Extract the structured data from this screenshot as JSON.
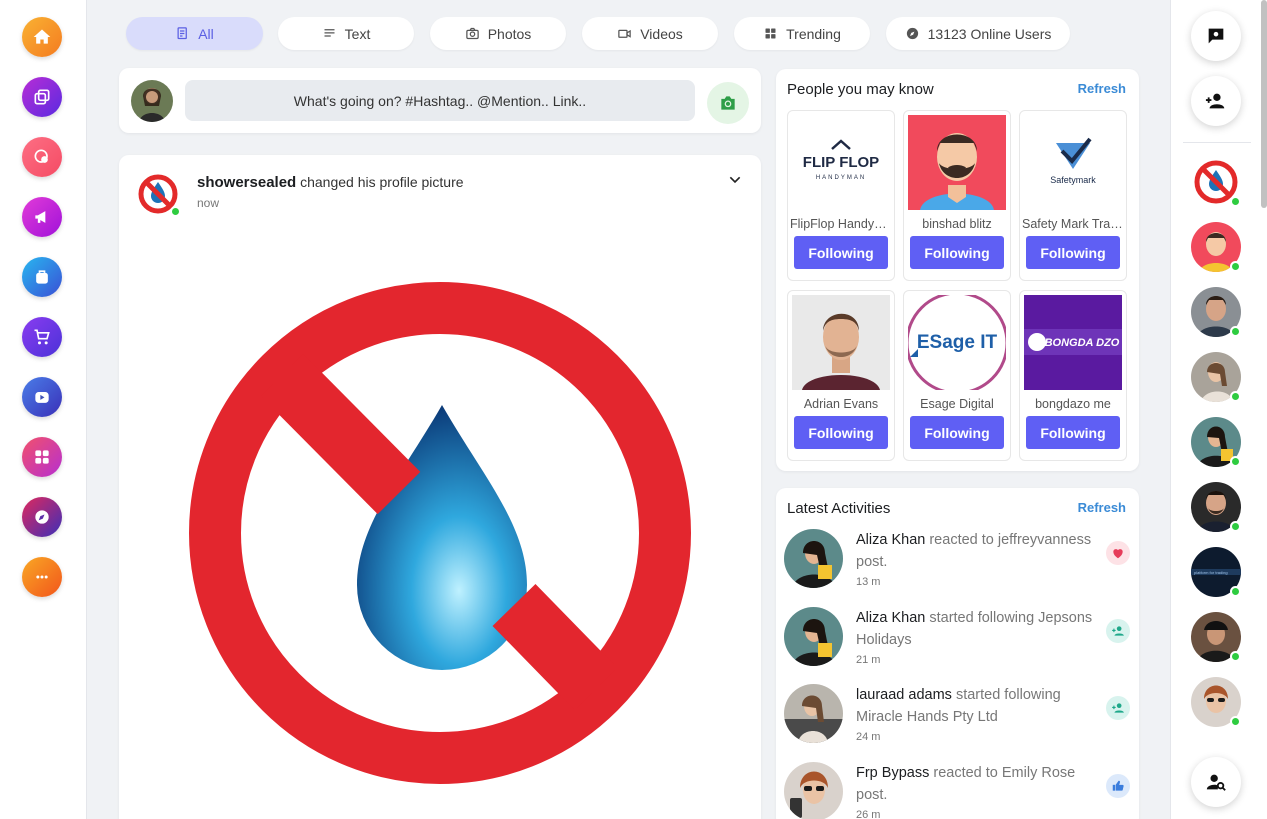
{
  "colors": {
    "accent": "#5f5ff4",
    "link": "#3b8bd6",
    "online": "#2ecc40"
  },
  "left_nav": [
    {
      "name": "home",
      "icon": "home-icon",
      "color": "#f7a21b"
    },
    {
      "name": "pages",
      "icon": "pages-icon",
      "color": "#8e2de2"
    },
    {
      "name": "groups",
      "icon": "groups-icon",
      "color": "#f64f59"
    },
    {
      "name": "ads",
      "icon": "megaphone-icon",
      "color": "#c622d6"
    },
    {
      "name": "market",
      "icon": "bag-icon",
      "color": "#3a7bd5"
    },
    {
      "name": "shop",
      "icon": "cart-icon",
      "color": "#6a3de8"
    },
    {
      "name": "watch",
      "icon": "video-icon",
      "color": "#3f51b5"
    },
    {
      "name": "apps",
      "icon": "apps-icon",
      "color": "#e94057"
    },
    {
      "name": "explore",
      "icon": "compass-icon",
      "color": "#5b2fa8"
    },
    {
      "name": "more",
      "icon": "more-icon",
      "color": "#f5a623"
    }
  ],
  "filters": {
    "all": "All",
    "text": "Text",
    "photos": "Photos",
    "videos": "Videos",
    "trending": "Trending",
    "online": "13123 Online Users"
  },
  "composer": {
    "placeholder": "What's going on? #Hashtag.. @Mention.. Link.."
  },
  "post": {
    "author": "showersealed",
    "action": " changed his profile picture",
    "time": "now"
  },
  "people": {
    "title": "People you may know",
    "refresh": "Refresh",
    "items": [
      {
        "name": "FlipFlop Handyman",
        "button": "Following"
      },
      {
        "name": "binshad blitz",
        "button": "Following"
      },
      {
        "name": "Safety Mark Training",
        "button": "Following"
      },
      {
        "name": "Adrian Evans",
        "button": "Following"
      },
      {
        "name": "Esage Digital",
        "button": "Following"
      },
      {
        "name": "bongdazo me",
        "button": "Following"
      }
    ],
    "logos": {
      "flipflop_top": "FLIP FLOP",
      "flipflop_sub": "HANDYMAN",
      "safety": "Safetymark",
      "esage": "ESage IT",
      "bongda": "BONGDA DZO"
    }
  },
  "activities": {
    "title": "Latest Activities",
    "refresh": "Refresh",
    "items": [
      {
        "actor": "Aliza Khan",
        "text": " reacted to jeffreyvanness post.",
        "time": "13 m",
        "badge": "heart-icon"
      },
      {
        "actor": "Aliza Khan",
        "text": " started following Jepsons Holidays",
        "time": "21 m",
        "badge": "add-user-icon"
      },
      {
        "actor": "lauraad adams",
        "text": " started following Miracle Hands Pty Ltd",
        "time": "24 m",
        "badge": "add-user-icon"
      },
      {
        "actor": "Frp Bypass",
        "text": " reacted to Emily Rose post.",
        "time": "26 m",
        "badge": "like-icon"
      }
    ]
  }
}
